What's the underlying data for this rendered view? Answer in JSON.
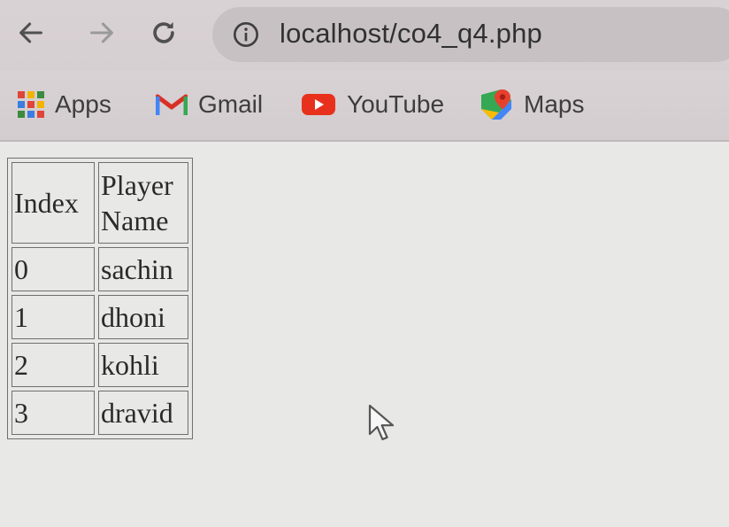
{
  "browser": {
    "url": "localhost/co4_q4.php",
    "bookmarks": [
      {
        "label": "Apps",
        "icon": "apps-grid-icon"
      },
      {
        "label": "Gmail",
        "icon": "gmail-icon"
      },
      {
        "label": "YouTube",
        "icon": "youtube-icon"
      },
      {
        "label": "Maps",
        "icon": "maps-icon"
      }
    ]
  },
  "table": {
    "headers": [
      "Index",
      "Player Name"
    ],
    "rows": [
      [
        "0",
        "sachin"
      ],
      [
        "1",
        "dhoni"
      ],
      [
        "2",
        "kohli"
      ],
      [
        "3",
        "dravid"
      ]
    ]
  },
  "colors": {
    "toolbar": "#d9d2d4",
    "omnibox": "#c8c1c4",
    "page_background": "#e8e8e6"
  }
}
